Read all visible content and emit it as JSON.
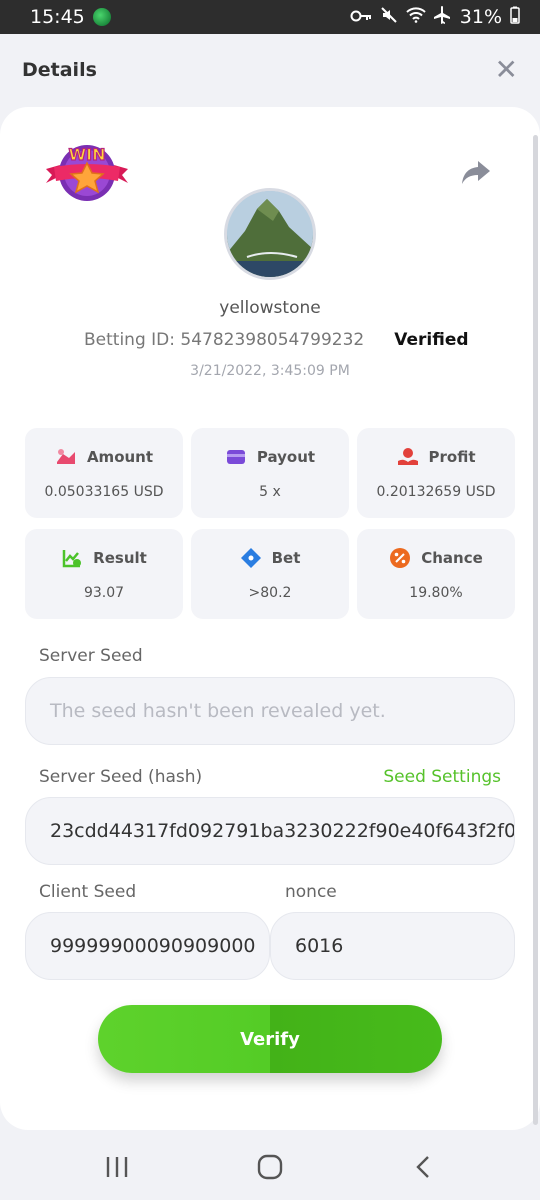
{
  "status_bar": {
    "time": "15:45",
    "battery": "31%"
  },
  "header": {
    "title": "Details",
    "close_label": "✕"
  },
  "badge": {
    "text": "WIN"
  },
  "user": {
    "name": "yellowstone"
  },
  "bet": {
    "id_label": "Betting ID: 54782398054799232",
    "verified": "Verified",
    "datetime": "3/21/2022, 3:45:09 PM"
  },
  "tiles": [
    {
      "label": "Amount",
      "value": "0.05033165 USD",
      "icon": "amount-icon",
      "color": "#e84a6f"
    },
    {
      "label": "Payout",
      "value": "5 x",
      "icon": "card-icon",
      "color": "#7a4ad8"
    },
    {
      "label": "Profit",
      "value": "0.20132659 USD",
      "icon": "profit-icon",
      "color": "#e2413b"
    },
    {
      "label": "Result",
      "value": "93.07",
      "icon": "result-icon",
      "color": "#4cc32a"
    },
    {
      "label": "Bet",
      "value": ">80.2",
      "icon": "bet-icon",
      "color": "#2a7de1"
    },
    {
      "label": "Chance",
      "value": "19.80%",
      "icon": "percent-icon",
      "color": "#ec6a1f"
    }
  ],
  "server_seed": {
    "label": "Server Seed",
    "placeholder": "The seed hasn't been revealed yet."
  },
  "server_seed_hash": {
    "label": "Server Seed (hash)",
    "link": "Seed Settings",
    "value": "23cdd44317fd092791ba3230222f90e40f643f2f0"
  },
  "client_seed": {
    "label": "Client Seed",
    "value": "99999900090909000"
  },
  "nonce": {
    "label": "nonce",
    "value": "6016"
  },
  "verify_button": {
    "label": "Verify"
  },
  "colors": {
    "accent": "#56c22b",
    "tile_bg": "#f3f4f8"
  }
}
